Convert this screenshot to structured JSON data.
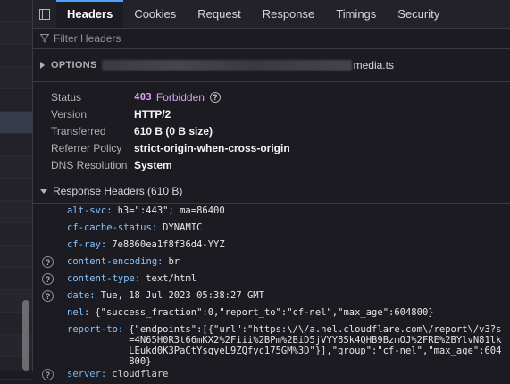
{
  "tabs": [
    "Headers",
    "Cookies",
    "Request",
    "Response",
    "Timings",
    "Security"
  ],
  "filter": {
    "placeholder": "Filter Headers"
  },
  "request": {
    "method": "OPTIONS",
    "url_tail": "media.ts"
  },
  "general": [
    {
      "key": "Status",
      "code": "403",
      "text": "Forbidden"
    },
    {
      "key": "Version",
      "value": "HTTP/2"
    },
    {
      "key": "Transferred",
      "value": "610 B (0 B size)"
    },
    {
      "key": "Referrer Policy",
      "value": "strict-origin-when-cross-origin"
    },
    {
      "key": "DNS Resolution",
      "value": "System"
    }
  ],
  "response_headers": {
    "title": "Response Headers (610 B)",
    "items": [
      {
        "name": "alt-svc:",
        "value": "h3=\":443\"; ma=86400",
        "help": false
      },
      {
        "name": "cf-cache-status:",
        "value": "DYNAMIC",
        "help": false
      },
      {
        "name": "cf-ray:",
        "value": "7e8860ea1f8f36d4-YYZ",
        "help": false
      },
      {
        "name": "content-encoding:",
        "value": "br",
        "help": true
      },
      {
        "name": "content-type:",
        "value": "text/html",
        "help": true
      },
      {
        "name": "date:",
        "value": "Tue, 18 Jul 2023 05:38:27 GMT",
        "help": true
      },
      {
        "name": "nel:",
        "value": "{\"success_fraction\":0,\"report_to\":\"cf-nel\",\"max_age\":604800}",
        "help": false
      },
      {
        "name": "report-to:",
        "value": "{\"endpoints\":[{\"url\":\"https:\\/\\/a.nel.cloudflare.com\\/report\\/v3?s=4N65H0R3t66mKX2%2Fiii%2BPm%2BiD5jVYY8Sk4QHB9BzmOJ%2FRE%2BYlvN81lkLEukd0K3PaCtYsqyeL9ZQfyc175GM%3D\"}],\"group\":\"cf-nel\",\"max_age\":604800}",
        "help": false
      },
      {
        "name": "server:",
        "value": "cloudflare",
        "help": true
      }
    ]
  }
}
